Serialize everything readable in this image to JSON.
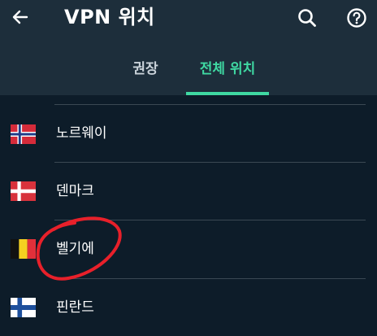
{
  "header": {
    "title": "VPN 위치",
    "back_icon": "arrow-left-icon",
    "search_icon": "search-icon",
    "help_icon": "question-circle-icon"
  },
  "tabs": [
    {
      "label": "권장",
      "active": false
    },
    {
      "label": "전체 위치",
      "active": true
    }
  ],
  "colors": {
    "header_bg": "#1d2e3b",
    "list_bg": "#0d1c29",
    "accent": "#3fd8a2",
    "annotation": "#e8202a"
  },
  "locations": [
    {
      "label": "노르웨이",
      "flag": "norway-flag-icon"
    },
    {
      "label": "덴마크",
      "flag": "denmark-flag-icon"
    },
    {
      "label": "벨기에",
      "flag": "belgium-flag-icon"
    },
    {
      "label": "핀란드",
      "flag": "finland-flag-icon"
    }
  ]
}
